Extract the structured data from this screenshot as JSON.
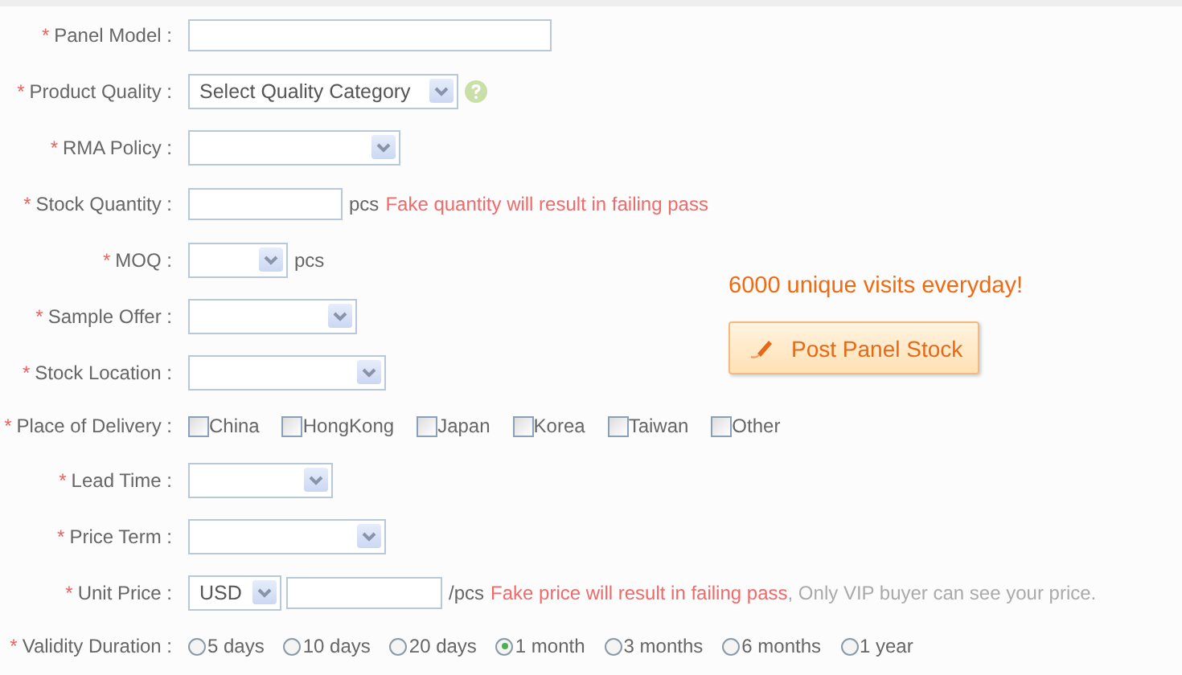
{
  "form": {
    "rows": [
      {
        "kind": "text",
        "mark": "*",
        "label": "Panel Model :"
      },
      {
        "kind": "select",
        "mark": "*",
        "label": "Product Quality :",
        "value": "Select Quality Category",
        "help": true
      },
      {
        "kind": "select",
        "mark": "*",
        "label": "RMA Policy :"
      },
      {
        "kind": "text",
        "mark": "*",
        "label": "Stock Quantity :",
        "suffix": "pcs",
        "warning": "Fake quantity will result in failing pass"
      },
      {
        "kind": "select",
        "mark": "*",
        "label": "MOQ :",
        "suffix": "pcs"
      },
      {
        "kind": "select",
        "mark": "*",
        "label": "Sample Offer :"
      },
      {
        "kind": "select",
        "mark": "*",
        "label": "Stock Location :"
      },
      {
        "kind": "checks",
        "mark": "*",
        "label": "Place of Delivery :",
        "options": [
          {
            "label": "China",
            "checked": false
          },
          {
            "label": "HongKong",
            "checked": false
          },
          {
            "label": "Japan",
            "checked": false
          },
          {
            "label": "Korea",
            "checked": false
          },
          {
            "label": "Taiwan",
            "checked": false
          },
          {
            "label": "Other",
            "checked": false
          }
        ]
      },
      {
        "kind": "select",
        "mark": "*",
        "label": "Lead Time :"
      },
      {
        "kind": "select",
        "mark": "*",
        "label": "Price Term :"
      },
      {
        "kind": "price",
        "mark": "*",
        "label": "Unit Price :",
        "currency": "USD",
        "suffix": "/pcs",
        "warning": "Fake price will result in failing pass",
        "note": ", Only VIP buyer can see your price."
      },
      {
        "kind": "radios",
        "mark": "*",
        "label": "Validity Duration :",
        "options": [
          {
            "label": "5 days",
            "selected": false
          },
          {
            "label": "10 days",
            "selected": false
          },
          {
            "label": "20 days",
            "selected": false
          },
          {
            "label": "1 month",
            "selected": true
          },
          {
            "label": "3 months",
            "selected": false
          },
          {
            "label": "6 months",
            "selected": false
          },
          {
            "label": "1 year",
            "selected": false
          }
        ]
      }
    ]
  },
  "promo": {
    "headline": "6000 unique visits everyday!",
    "button": "Post Panel Stock"
  }
}
